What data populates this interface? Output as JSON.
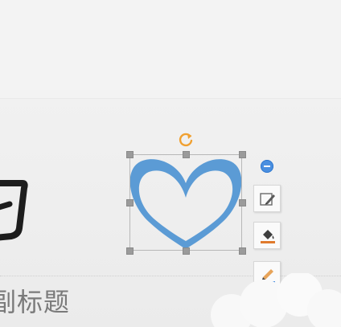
{
  "slide": {
    "subtitle": "副标题"
  },
  "shape": {
    "type": "heart",
    "fill_color": "#5b9bd5",
    "icon": "heart-icon"
  },
  "selection": {
    "handle_color": "#9b9b9b",
    "rotate_icon": "rotate-icon",
    "rotate_color": "#f0a030"
  },
  "side_toolbar": {
    "collapse_icon": "minus-icon",
    "buttons": [
      {
        "icon": "shape-style-icon"
      },
      {
        "icon": "fill-bucket-icon",
        "accent": "#e07a2c"
      },
      {
        "icon": "outline-pen-icon",
        "accent": "#4a8fe0"
      }
    ]
  }
}
